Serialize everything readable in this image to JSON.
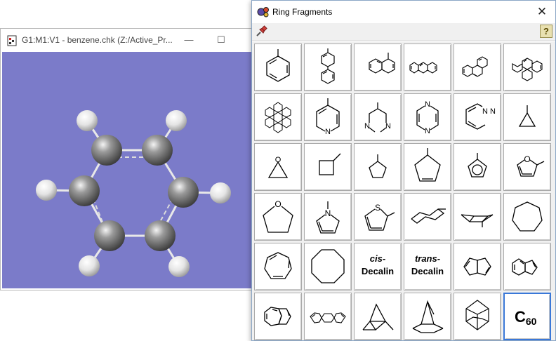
{
  "viewer": {
    "title": "G1:M1:V1 - benzene.chk (Z:/Active_Pr...",
    "minimize_glyph": "—",
    "maximize_glyph": "☐",
    "background_color": "#7b7bc9"
  },
  "ring_fragments": {
    "title": "Ring Fragments",
    "close_glyph": "✕",
    "help_glyph": "?",
    "fragments": [
      {
        "id": "benzene",
        "icon": "benzene-icon"
      },
      {
        "id": "biphenyl",
        "icon": "biphenyl-icon"
      },
      {
        "id": "naphthalene",
        "icon": "naphthalene-icon"
      },
      {
        "id": "anthracene",
        "icon": "anthracene-icon"
      },
      {
        "id": "phenanthrene",
        "icon": "phenanthrene-icon"
      },
      {
        "id": "pyrene",
        "icon": "pyrene-icon"
      },
      {
        "id": "coronene",
        "icon": "coronene-icon"
      },
      {
        "id": "pyridine",
        "icon": "pyridine-icon",
        "atom": "N"
      },
      {
        "id": "pyrimidine",
        "icon": "pyrimidine-icon",
        "atom": "N"
      },
      {
        "id": "pyrazine",
        "icon": "pyrazine-icon",
        "atom": "N"
      },
      {
        "id": "pyridazine",
        "icon": "pyridazine-icon",
        "atom": "N"
      },
      {
        "id": "cyclopropane",
        "icon": "cyclopropane-icon"
      },
      {
        "id": "oxirane",
        "icon": "oxirane-icon",
        "atom": "O"
      },
      {
        "id": "cyclobutane",
        "icon": "cyclobutane-icon"
      },
      {
        "id": "cyclopentane",
        "icon": "cyclopentane-icon"
      },
      {
        "id": "cyclopentene",
        "icon": "cyclopentene-icon"
      },
      {
        "id": "cyclopentadienyl",
        "icon": "cyclopentadienyl-icon"
      },
      {
        "id": "furan",
        "icon": "furan-icon",
        "atom": "O"
      },
      {
        "id": "tetrahydrofuran",
        "icon": "tetrahydrofuran-icon",
        "atom": "O"
      },
      {
        "id": "pyrrole",
        "icon": "pyrrole-icon",
        "atom": "N"
      },
      {
        "id": "thiophene",
        "icon": "thiophene-icon",
        "atom": "S"
      },
      {
        "id": "cyclohexane-chair",
        "icon": "cyclohexane-chair-icon"
      },
      {
        "id": "cyclohexane-boat",
        "icon": "cyclohexane-boat-icon"
      },
      {
        "id": "cycloheptane",
        "icon": "cycloheptane-icon"
      },
      {
        "id": "cycloheptatriene",
        "icon": "cycloheptatriene-icon"
      },
      {
        "id": "cyclooctane",
        "icon": "cyclooctane-icon"
      },
      {
        "id": "cis-decalin",
        "line1": "cis-",
        "line2": "Decalin"
      },
      {
        "id": "trans-decalin",
        "line1": "trans-",
        "line2": "Decalin"
      },
      {
        "id": "pentalene",
        "icon": "pentalene-icon"
      },
      {
        "id": "indene",
        "icon": "indene-icon"
      },
      {
        "id": "azulene",
        "icon": "azulene-icon"
      },
      {
        "id": "fluorene",
        "icon": "fluorene-icon"
      },
      {
        "id": "norbornane",
        "icon": "norbornane-icon"
      },
      {
        "id": "bicyclooctane",
        "icon": "bicyclooctane-icon"
      },
      {
        "id": "adamantane",
        "icon": "adamantane-icon"
      },
      {
        "id": "c60",
        "label": "C",
        "subscript": "60",
        "selected": true
      }
    ]
  }
}
